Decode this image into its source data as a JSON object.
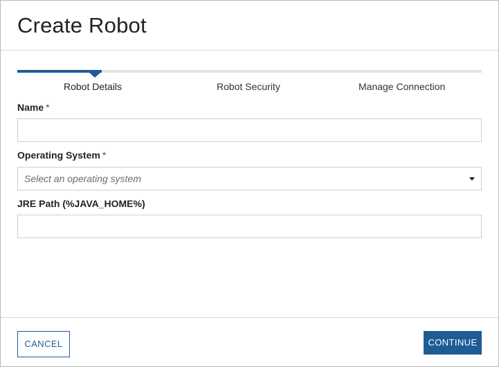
{
  "dialog": {
    "title": "Create Robot"
  },
  "stepper": {
    "steps": [
      {
        "label": "Robot Details",
        "active": true
      },
      {
        "label": "Robot Security",
        "active": false
      },
      {
        "label": "Manage Connection",
        "active": false
      }
    ],
    "accent": "#1e5c96"
  },
  "form": {
    "name": {
      "label": "Name",
      "required_marker": "*",
      "value": ""
    },
    "operating_system": {
      "label": "Operating System",
      "required_marker": "*",
      "placeholder": "Select an operating system",
      "icon": "caret-down-icon"
    },
    "jre_path": {
      "label": "JRE Path (%JAVA_HOME%)",
      "value": ""
    }
  },
  "footer": {
    "cancel_label": "CANCEL",
    "continue_label": "CONTINUE"
  }
}
